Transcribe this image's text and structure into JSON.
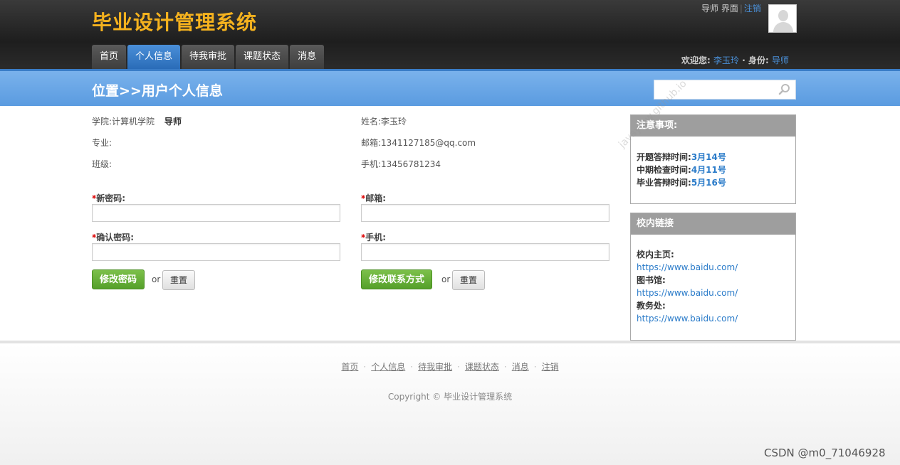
{
  "header": {
    "title": "毕业设计管理系统",
    "role_area": "导师 界面",
    "logout": "注销",
    "welcome_label": "欢迎您:",
    "user_name": "李玉玲",
    "identity_label": "· 身份:",
    "identity": "导师"
  },
  "nav": {
    "tabs": [
      {
        "label": "首页",
        "active": false
      },
      {
        "label": "个人信息",
        "active": true
      },
      {
        "label": "待我审批",
        "active": false
      },
      {
        "label": "课题状态",
        "active": false
      },
      {
        "label": "消息",
        "active": false
      }
    ]
  },
  "location": {
    "title": "位置>>用户个人信息",
    "search_placeholder": ""
  },
  "profile": {
    "college": "学院:计算机学院",
    "role": "导师",
    "major": "专业:",
    "class": "班级:",
    "name": "姓名:李玉玲",
    "email": "邮箱:1341127185@qq.com",
    "phone": "手机:13456781234"
  },
  "form": {
    "new_password_label": "新密码:",
    "confirm_password_label": "确认密码:",
    "email_label": "邮箱:",
    "phone_label": "手机:",
    "required_mark": "*",
    "change_password_btn": "修改密码",
    "change_contact_btn": "修改联系方式",
    "reset_btn": "重置",
    "or": "or"
  },
  "notice": {
    "heading": "注意事项:",
    "items": [
      {
        "label": "开题答辩时间:",
        "value": "3月14号"
      },
      {
        "label": "中期检查时间:",
        "value": "4月11号"
      },
      {
        "label": "毕业答辩时间:",
        "value": "5月16号"
      }
    ]
  },
  "links": {
    "heading": "校内链接",
    "items": [
      {
        "label": "校内主页:",
        "url": "https://www.baidu.com/"
      },
      {
        "label": "图书馆:",
        "url": "https://www.baidu.com/"
      },
      {
        "label": "教务处:",
        "url": "https://www.baidu.com/"
      }
    ]
  },
  "footer": {
    "links": [
      "首页",
      "个人信息",
      "待我审批",
      "课题状态",
      "消息",
      "注销"
    ],
    "copyright": "Copyright © 毕业设计管理系统"
  },
  "watermark": "javaymw.github.io",
  "csdn_tag": "CSDN @m0_71046928",
  "colors": {
    "title": "#f5b21e",
    "active_tab": "#2a6cb8",
    "loc_bar": "#5a9be0",
    "link": "#2a7bc9",
    "btn_green": "#55a02a"
  }
}
